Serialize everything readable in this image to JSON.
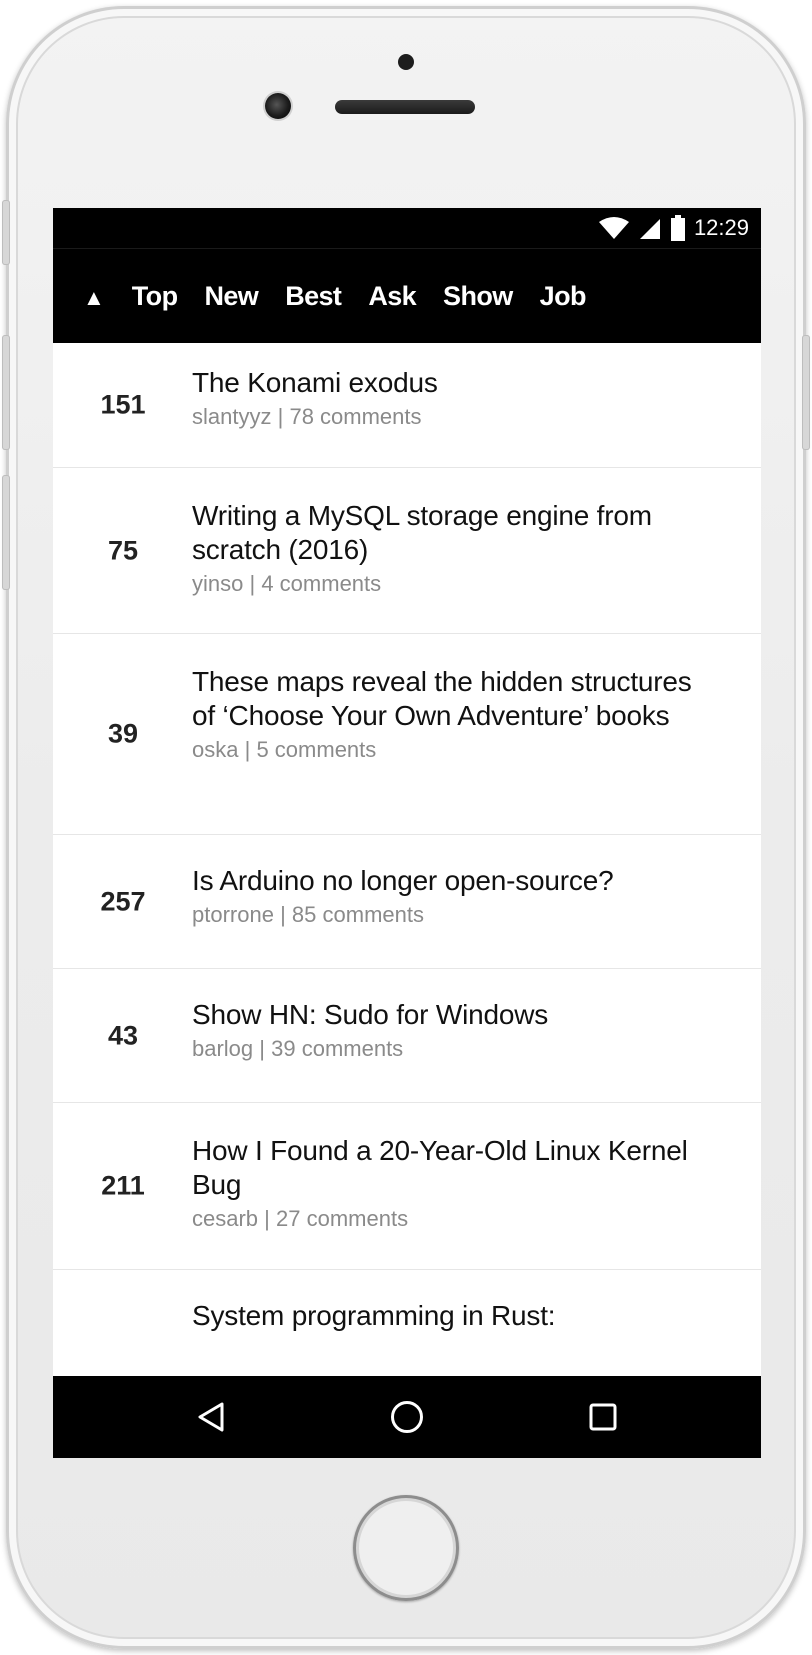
{
  "status_bar": {
    "time": "12:29",
    "icons": [
      "wifi-icon",
      "cell-signal-icon",
      "battery-icon"
    ]
  },
  "nav": {
    "arrow_glyph": "▲",
    "tabs": [
      {
        "label": "Top"
      },
      {
        "label": "New"
      },
      {
        "label": "Best"
      },
      {
        "label": "Ask"
      },
      {
        "label": "Show"
      },
      {
        "label": "Job"
      }
    ]
  },
  "stories": [
    {
      "score": "151",
      "title": "The Konami exodus",
      "user": "slantyyz",
      "comments": "78 comments"
    },
    {
      "score": "75",
      "title": "Writing a MySQL storage engine from scratch (2016)",
      "user": "yinso",
      "comments": "4 comments"
    },
    {
      "score": "39",
      "title": "These maps reveal the hidden structures of ‘Choose Your Own Adventure’ books",
      "user": "oska",
      "comments": "5 comments"
    },
    {
      "score": "257",
      "title": "Is Arduino no longer open-source?",
      "user": "ptorrone",
      "comments": "85 comments"
    },
    {
      "score": "43",
      "title": "Show HN: Sudo for Windows",
      "user": "barlog",
      "comments": "39 comments"
    },
    {
      "score": "211",
      "title": "How I Found a 20-Year-Old Linux Kernel Bug",
      "user": "cesarb",
      "comments": "27 comments"
    },
    {
      "score": "",
      "title": "System programming in Rust:",
      "user": "",
      "comments": ""
    }
  ],
  "meta_separator": "|",
  "system_nav": {
    "buttons": [
      "back-icon",
      "home-circle-icon",
      "recents-square-icon"
    ]
  },
  "colors": {
    "bar_background": "#000000",
    "text": "#111111",
    "meta_text": "#8a8a8a",
    "divider": "#e6e6e6"
  }
}
